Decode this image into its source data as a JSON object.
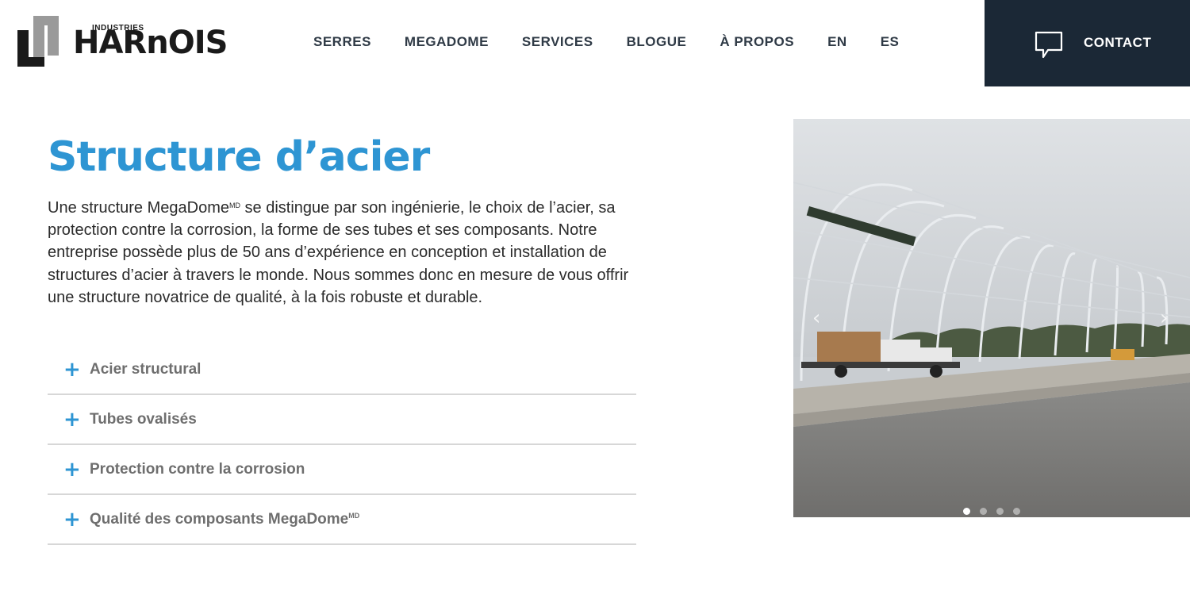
{
  "brand": {
    "small": "INDUSTRIES",
    "name": "HARnOIS"
  },
  "nav": {
    "items": [
      {
        "label": "SERRES"
      },
      {
        "label": "MEGADOME"
      },
      {
        "label": "SERVICES"
      },
      {
        "label": "BLOGUE"
      },
      {
        "label": "À PROPOS"
      },
      {
        "label": "EN"
      },
      {
        "label": "ES"
      }
    ]
  },
  "contact": {
    "label": "CONTACT",
    "icon": "speech-bubble-icon",
    "background": "#1b2836"
  },
  "content": {
    "title": "Structure d’acier",
    "description_part1": "Une structure MegaDome",
    "description_sup": "MD",
    "description_part2": " se distingue par son ingénierie, le choix de l’acier, sa protection contre la corrosion, la forme de ses tubes et ses composants. Notre entreprise possède plus de 50 ans d’expérience en conception et installation de structures d’acier à travers le monde. Nous sommes donc en mesure de vous offrir une structure novatrice de qualité, à la fois robuste et durable."
  },
  "accordion": {
    "items": [
      {
        "label": "Acier structural",
        "sup": ""
      },
      {
        "label": "Tubes ovalisés",
        "sup": ""
      },
      {
        "label": "Protection contre la corrosion",
        "sup": ""
      },
      {
        "label": "Qualité des composants MegaDome",
        "sup": "MD"
      }
    ],
    "icon": "plus-icon"
  },
  "slider": {
    "slide_count": 4,
    "active_index": 0,
    "prev_icon": "chevron-left-icon",
    "next_icon": "chevron-right-icon"
  },
  "colors": {
    "accent": "#2e95d3",
    "dark": "#1b2836",
    "nav_text": "#2f3a46"
  }
}
